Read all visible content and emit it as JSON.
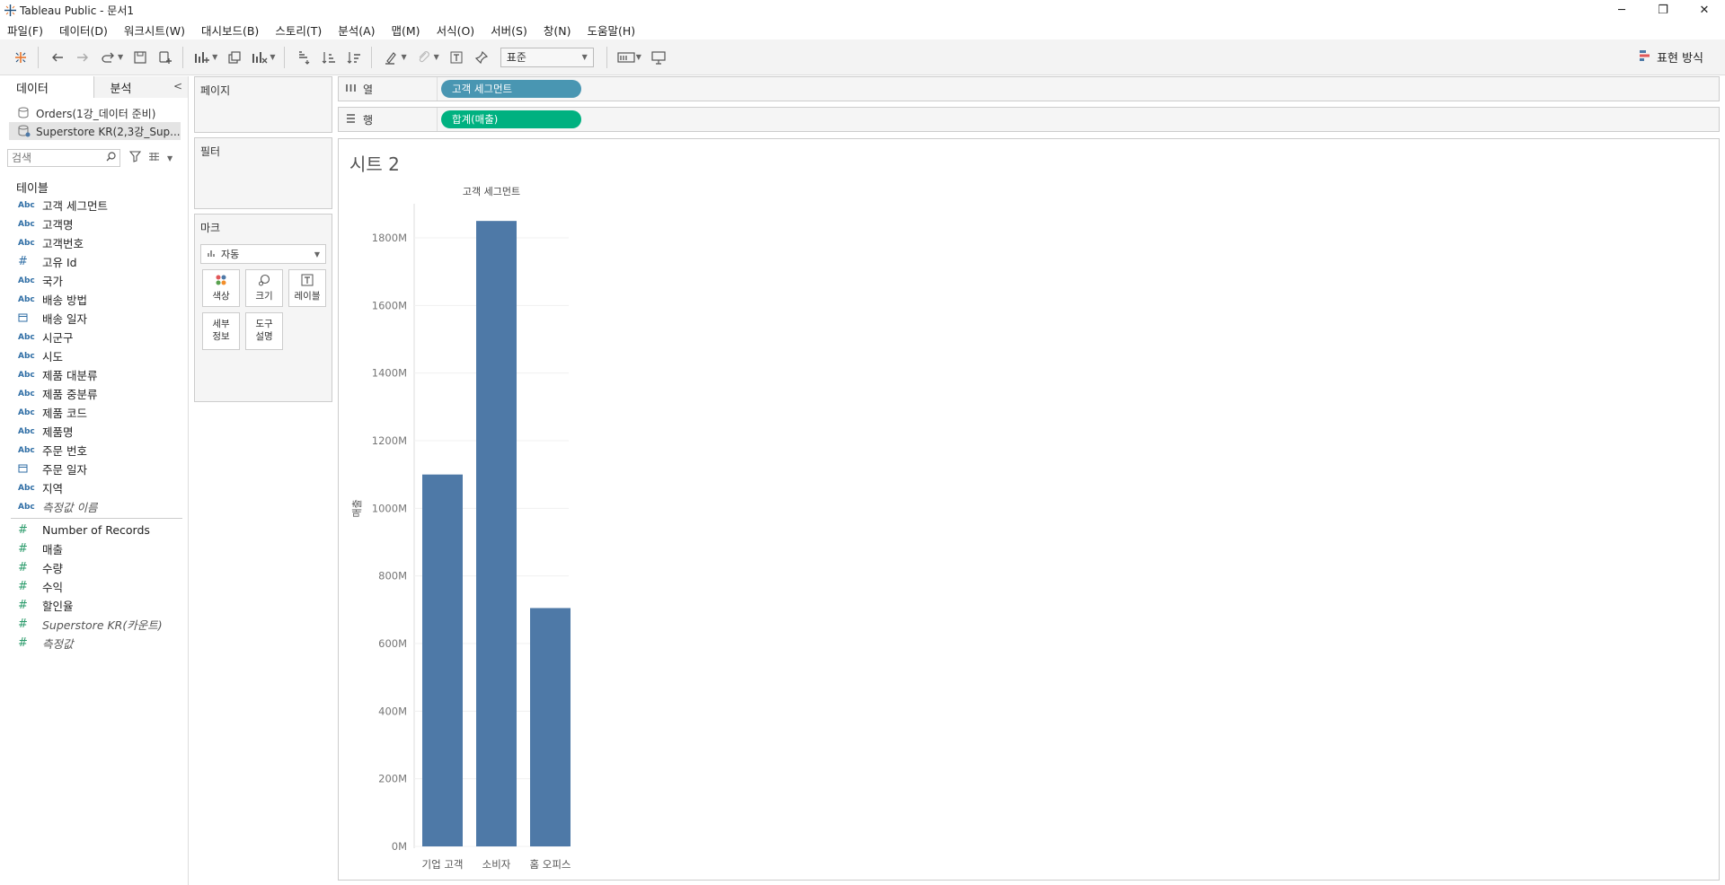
{
  "window": {
    "title": "Tableau Public - 문서1",
    "controls": {
      "minimize": "─",
      "restore": "❐",
      "close": "✕"
    }
  },
  "menu": [
    "파일(F)",
    "데이터(D)",
    "워크시트(W)",
    "대시보드(B)",
    "스토리(T)",
    "분석(A)",
    "맵(M)",
    "서식(O)",
    "서버(S)",
    "창(N)",
    "도움말(H)"
  ],
  "toolbar": {
    "fit_select": "표준",
    "show_me_label": "표현 방식"
  },
  "data_pane": {
    "tabs": {
      "data": "데이터",
      "analytics": "분석"
    },
    "datasources": [
      "Orders(1강_데이터 준비)",
      "Superstore KR(2,3강_Sup..."
    ],
    "search_placeholder": "검색",
    "section_title": "테이블",
    "dimensions": [
      {
        "type": "Abc",
        "name": "고객 세그먼트"
      },
      {
        "type": "Abc",
        "name": "고객명"
      },
      {
        "type": "Abc",
        "name": "고객번호"
      },
      {
        "type": "#",
        "name": "고유 Id"
      },
      {
        "type": "Abc",
        "name": "국가"
      },
      {
        "type": "Abc",
        "name": "배송 방법"
      },
      {
        "type": "date",
        "name": "배송 일자"
      },
      {
        "type": "Abc",
        "name": "시군구"
      },
      {
        "type": "Abc",
        "name": "시도"
      },
      {
        "type": "Abc",
        "name": "제품 대분류"
      },
      {
        "type": "Abc",
        "name": "제품 중분류"
      },
      {
        "type": "Abc",
        "name": "제품 코드"
      },
      {
        "type": "Abc",
        "name": "제품명"
      },
      {
        "type": "Abc",
        "name": "주문 번호"
      },
      {
        "type": "date",
        "name": "주문 일자"
      },
      {
        "type": "Abc",
        "name": "지역"
      },
      {
        "type": "Abc",
        "name": "측정값 이름",
        "italic": true
      }
    ],
    "measures": [
      {
        "name": "Number of Records"
      },
      {
        "name": "매출"
      },
      {
        "name": "수량"
      },
      {
        "name": "수익"
      },
      {
        "name": "할인율"
      },
      {
        "name": "Superstore KR(카운트)",
        "italic": true
      },
      {
        "name": "측정값",
        "italic": true
      }
    ]
  },
  "cards": {
    "pages": "페이지",
    "filters": "필터",
    "marks": "마크",
    "mark_type": "자동",
    "mark_buttons": [
      "색상",
      "크기",
      "레이블",
      "세부\n정보",
      "도구\n설명"
    ]
  },
  "shelves": {
    "columns_label": "열",
    "rows_label": "행",
    "columns_pill": "고객 세그먼트",
    "rows_pill": "합계(매출)"
  },
  "sheet": {
    "title": "시트 2"
  },
  "chart_data": {
    "type": "bar",
    "title": "",
    "header": "고객 세그먼트",
    "categories": [
      "기업 고객",
      "소비자",
      "홈 오피스"
    ],
    "values": [
      1100,
      1850,
      705
    ],
    "ylabel": "매출",
    "ylim": [
      0,
      1900
    ],
    "yticks": [
      0,
      200,
      400,
      600,
      800,
      1000,
      1200,
      1400,
      1600,
      1800
    ],
    "ytick_labels": [
      "0M",
      "200M",
      "400M",
      "600M",
      "800M",
      "1000M",
      "1200M",
      "1400M",
      "1600M",
      "1800M"
    ],
    "bar_color": "#4e79a7",
    "grid": true
  },
  "colors": {
    "dimension_pill": "#4996b2",
    "measure_pill": "#00b180"
  }
}
